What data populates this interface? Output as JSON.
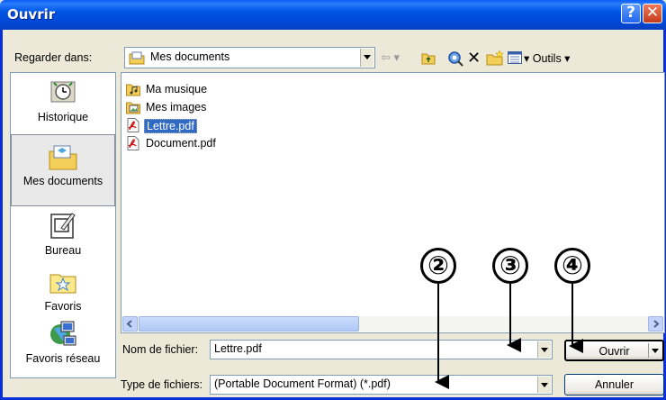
{
  "window": {
    "title": "Ouvrir",
    "help_glyph": "?",
    "close_glyph": "✕"
  },
  "toolbar": {
    "look_in_label": "Regarder dans:",
    "look_in_value": "Mes documents",
    "tools_label": "▾ Outils ▾",
    "back_glyph": "⇦ ▾",
    "delete_glyph": "✕"
  },
  "places": [
    {
      "label": "Historique",
      "icon": "history-clock-icon"
    },
    {
      "label": "Mes documents",
      "icon": "my-documents-folder-icon"
    },
    {
      "label": "Bureau",
      "icon": "desktop-icon"
    },
    {
      "label": "Favoris",
      "icon": "favorites-star-icon"
    },
    {
      "label": "Favoris réseau",
      "icon": "network-places-icon"
    }
  ],
  "files": [
    {
      "name": "Ma musique",
      "icon": "folder-music-icon"
    },
    {
      "name": "Mes images",
      "icon": "folder-images-icon"
    },
    {
      "name": "Lettre.pdf",
      "icon": "pdf-file-icon",
      "selected": true
    },
    {
      "name": "Document.pdf",
      "icon": "pdf-file-icon"
    }
  ],
  "filename": {
    "label": "Nom de fichier:",
    "value": "Lettre.pdf"
  },
  "filetype": {
    "label": "Type de fichiers:",
    "value": "(Portable Document Format) (*.pdf)"
  },
  "buttons": {
    "open": "Ouvrir",
    "cancel": "Annuler"
  },
  "annotations": [
    "②",
    "③",
    "④"
  ],
  "colors": {
    "title_bar": "#0054e3",
    "selection": "#316ac5",
    "dialog_bg": "#ece9d8"
  }
}
